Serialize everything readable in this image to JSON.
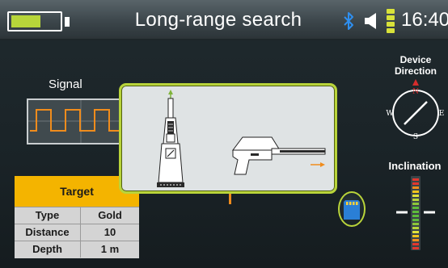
{
  "status_bar": {
    "title": "Long-range search",
    "clock": "16:40",
    "battery_level": 0.62,
    "icons": [
      "battery-icon",
      "bluetooth-icon",
      "speaker-icon",
      "signal-strength-icon"
    ]
  },
  "signal_panel": {
    "label": "Signal"
  },
  "target": {
    "heading": "Target",
    "rows": [
      {
        "key": "Type",
        "value": "Gold"
      },
      {
        "key": "Distance",
        "value": "10"
      },
      {
        "key": "Depth",
        "value": "1 m"
      }
    ]
  },
  "device_direction": {
    "label": "Device Direction",
    "compass_letters": [
      "N",
      "E",
      "S",
      "W"
    ]
  },
  "inclination": {
    "label": "Inclination"
  },
  "colors": {
    "accent": "#b9d43a",
    "target_header": "#f4b400",
    "signal_wave": "#f08c1c",
    "compass_north": "#d62c2c"
  }
}
